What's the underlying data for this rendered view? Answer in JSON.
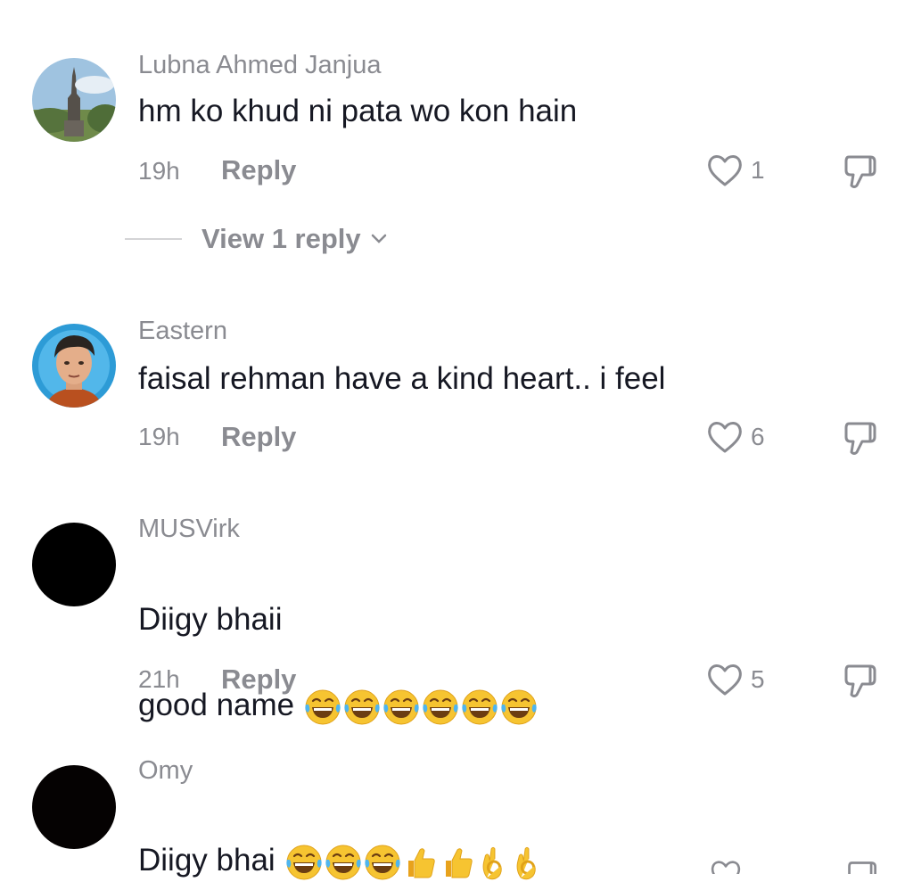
{
  "comments": [
    {
      "username": "Lubna Ahmed Janjua",
      "text": "hm ko khud ni pata wo kon hain",
      "time": "19h",
      "reply_label": "Reply",
      "likes": "1",
      "view_replies": "View 1 reply"
    },
    {
      "username": "Eastern",
      "text": "faisal rehman have a kind heart.. i feel",
      "time": "19h",
      "reply_label": "Reply",
      "likes": "6"
    },
    {
      "username": "MUSVirk",
      "text_line1": "Diigy bhaii",
      "text_line2": "good name",
      "emojis": [
        "face-with-tears-of-joy",
        "face-with-tears-of-joy",
        "face-with-tears-of-joy",
        "face-with-tears-of-joy",
        "face-with-tears-of-joy",
        "face-with-tears-of-joy"
      ],
      "time": "21h",
      "reply_label": "Reply",
      "likes": "5"
    },
    {
      "username": "Omy",
      "text": "Diigy bhai",
      "emojis": [
        "face-with-tears-of-joy",
        "face-with-tears-of-joy",
        "face-with-tears-of-joy",
        "thumbs-up",
        "thumbs-up",
        "ok-hand",
        "ok-hand"
      ]
    }
  ],
  "colors": {
    "secondary_text": "#8a8b91",
    "primary_text": "#161823",
    "emoji_yellow": "#f5c33b"
  },
  "icons": {
    "like": "heart-outline-icon",
    "dislike": "thumbs-down-outline-icon",
    "expand": "chevron-down-icon"
  }
}
